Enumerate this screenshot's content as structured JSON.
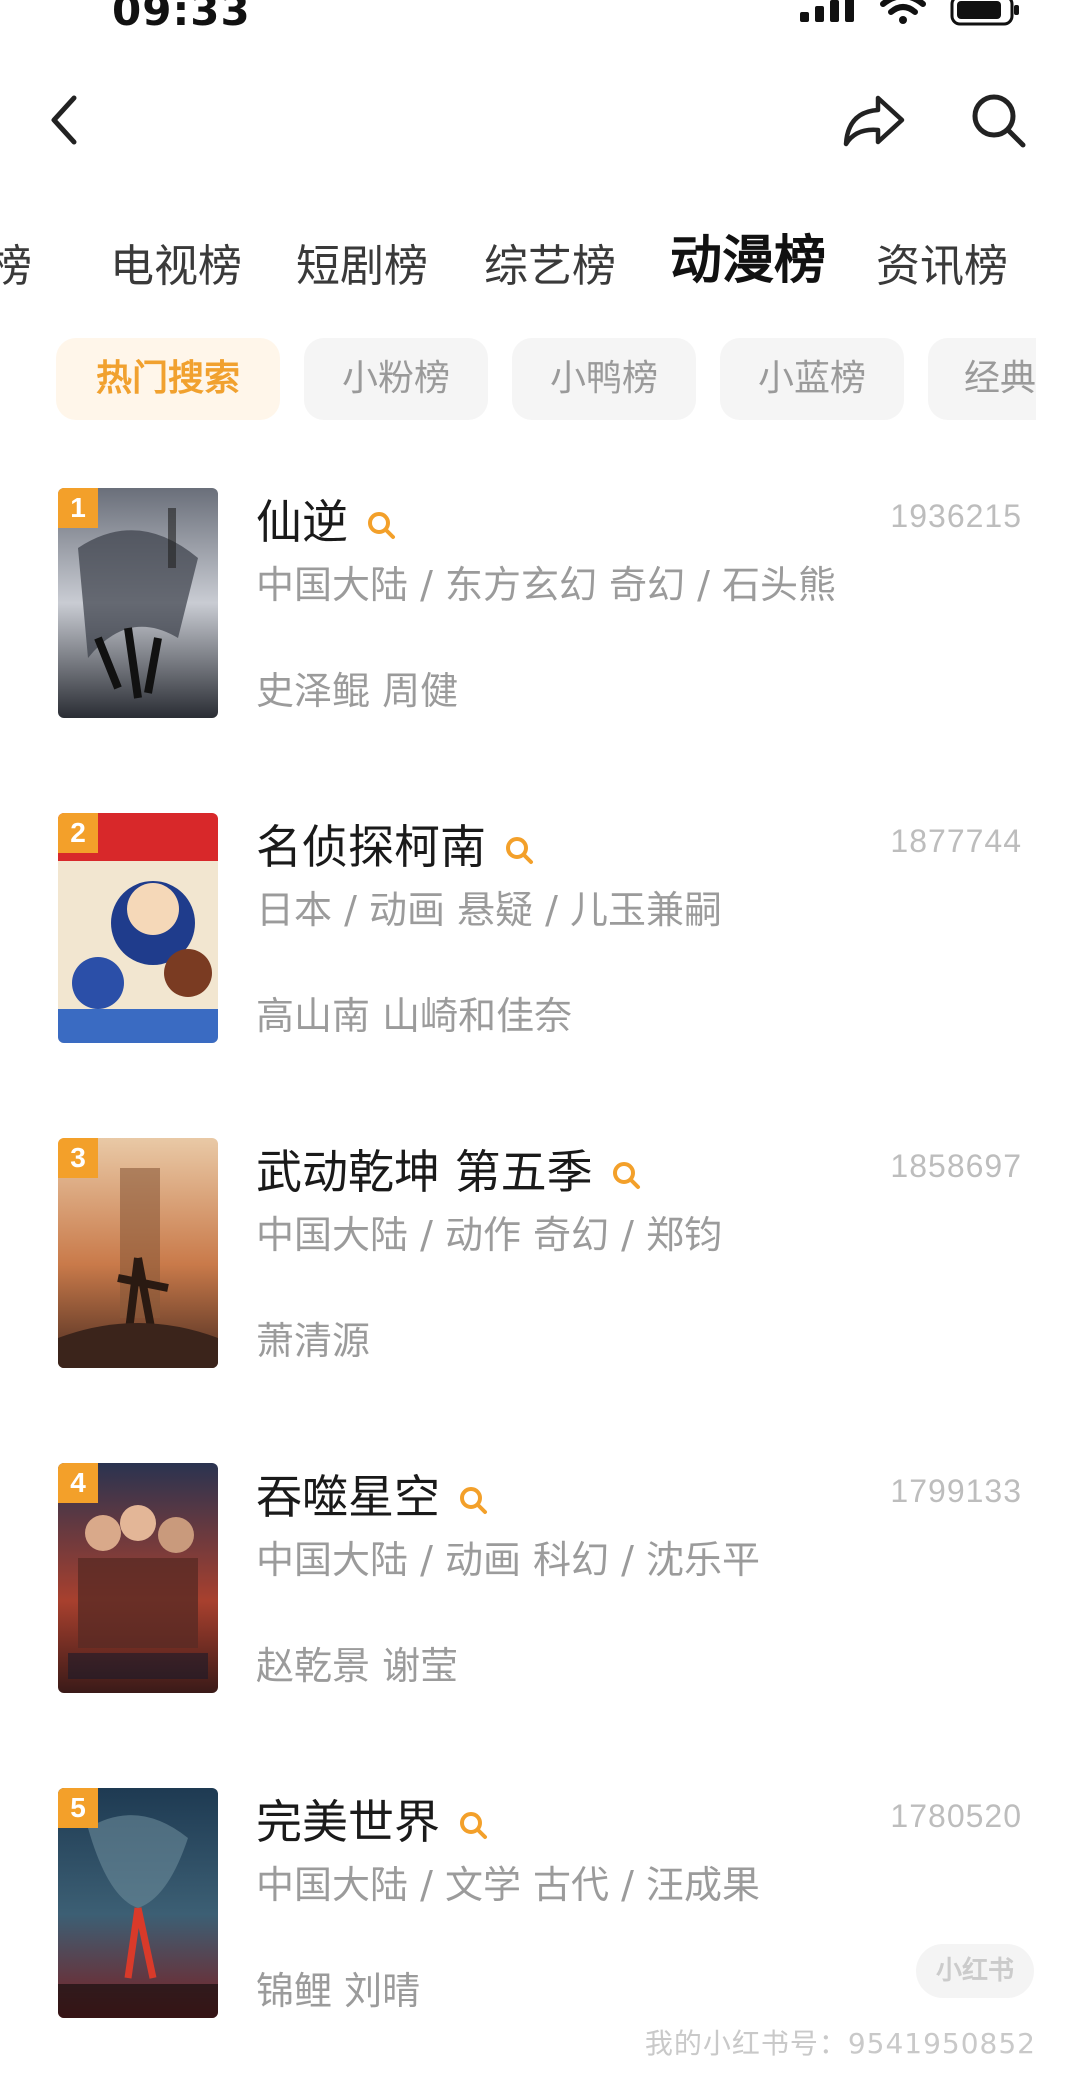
{
  "status_bar": {
    "time": "09:33",
    "icons": [
      "signal-icon",
      "wifi-icon",
      "battery-icon"
    ]
  },
  "header": {
    "back_icon": "chevron-left-icon",
    "share_icon": "share-icon",
    "search_icon": "search-icon"
  },
  "main_tabs": [
    {
      "label": "榜",
      "active": false
    },
    {
      "label": "电视榜",
      "active": false
    },
    {
      "label": "短剧榜",
      "active": false
    },
    {
      "label": "综艺榜",
      "active": false
    },
    {
      "label": "动漫榜",
      "active": true
    },
    {
      "label": "资讯榜",
      "active": false
    }
  ],
  "sub_tabs": [
    {
      "label": "热门搜索",
      "active": true
    },
    {
      "label": "小粉榜",
      "active": false
    },
    {
      "label": "小鸭榜",
      "active": false
    },
    {
      "label": "小蓝榜",
      "active": false
    },
    {
      "label": "经典",
      "active": false
    }
  ],
  "items": [
    {
      "rank": "1",
      "title": "仙逆",
      "score": "1936215",
      "meta": "中国大陆 / 东方玄幻 奇幻 / 石头熊",
      "cast": "史泽鲲 周健"
    },
    {
      "rank": "2",
      "title": "名侦探柯南",
      "score": "1877744",
      "meta": "日本 / 动画 悬疑 / 儿玉兼嗣",
      "cast": "高山南 山崎和佳奈"
    },
    {
      "rank": "3",
      "title": "武动乾坤 第五季",
      "score": "1858697",
      "meta": "中国大陆 / 动作 奇幻 / 郑钧",
      "cast": "萧清源"
    },
    {
      "rank": "4",
      "title": "吞噬星空",
      "score": "1799133",
      "meta": "中国大陆 / 动画 科幻 / 沈乐平",
      "cast": "赵乾景 谢莹"
    },
    {
      "rank": "5",
      "title": "完美世界",
      "score": "1780520",
      "meta": "中国大陆 / 文学 古代 / 汪成果",
      "cast": "锦鲤 刘晴"
    }
  ],
  "watermark": {
    "badge": "小红书",
    "text": "我的小红书号：9541950852"
  },
  "colors": {
    "accent": "#f3a02a",
    "chip_active_bg": "#fff6ea",
    "chip_bg": "#f5f5f5",
    "muted_text": "#9b9b9b"
  }
}
